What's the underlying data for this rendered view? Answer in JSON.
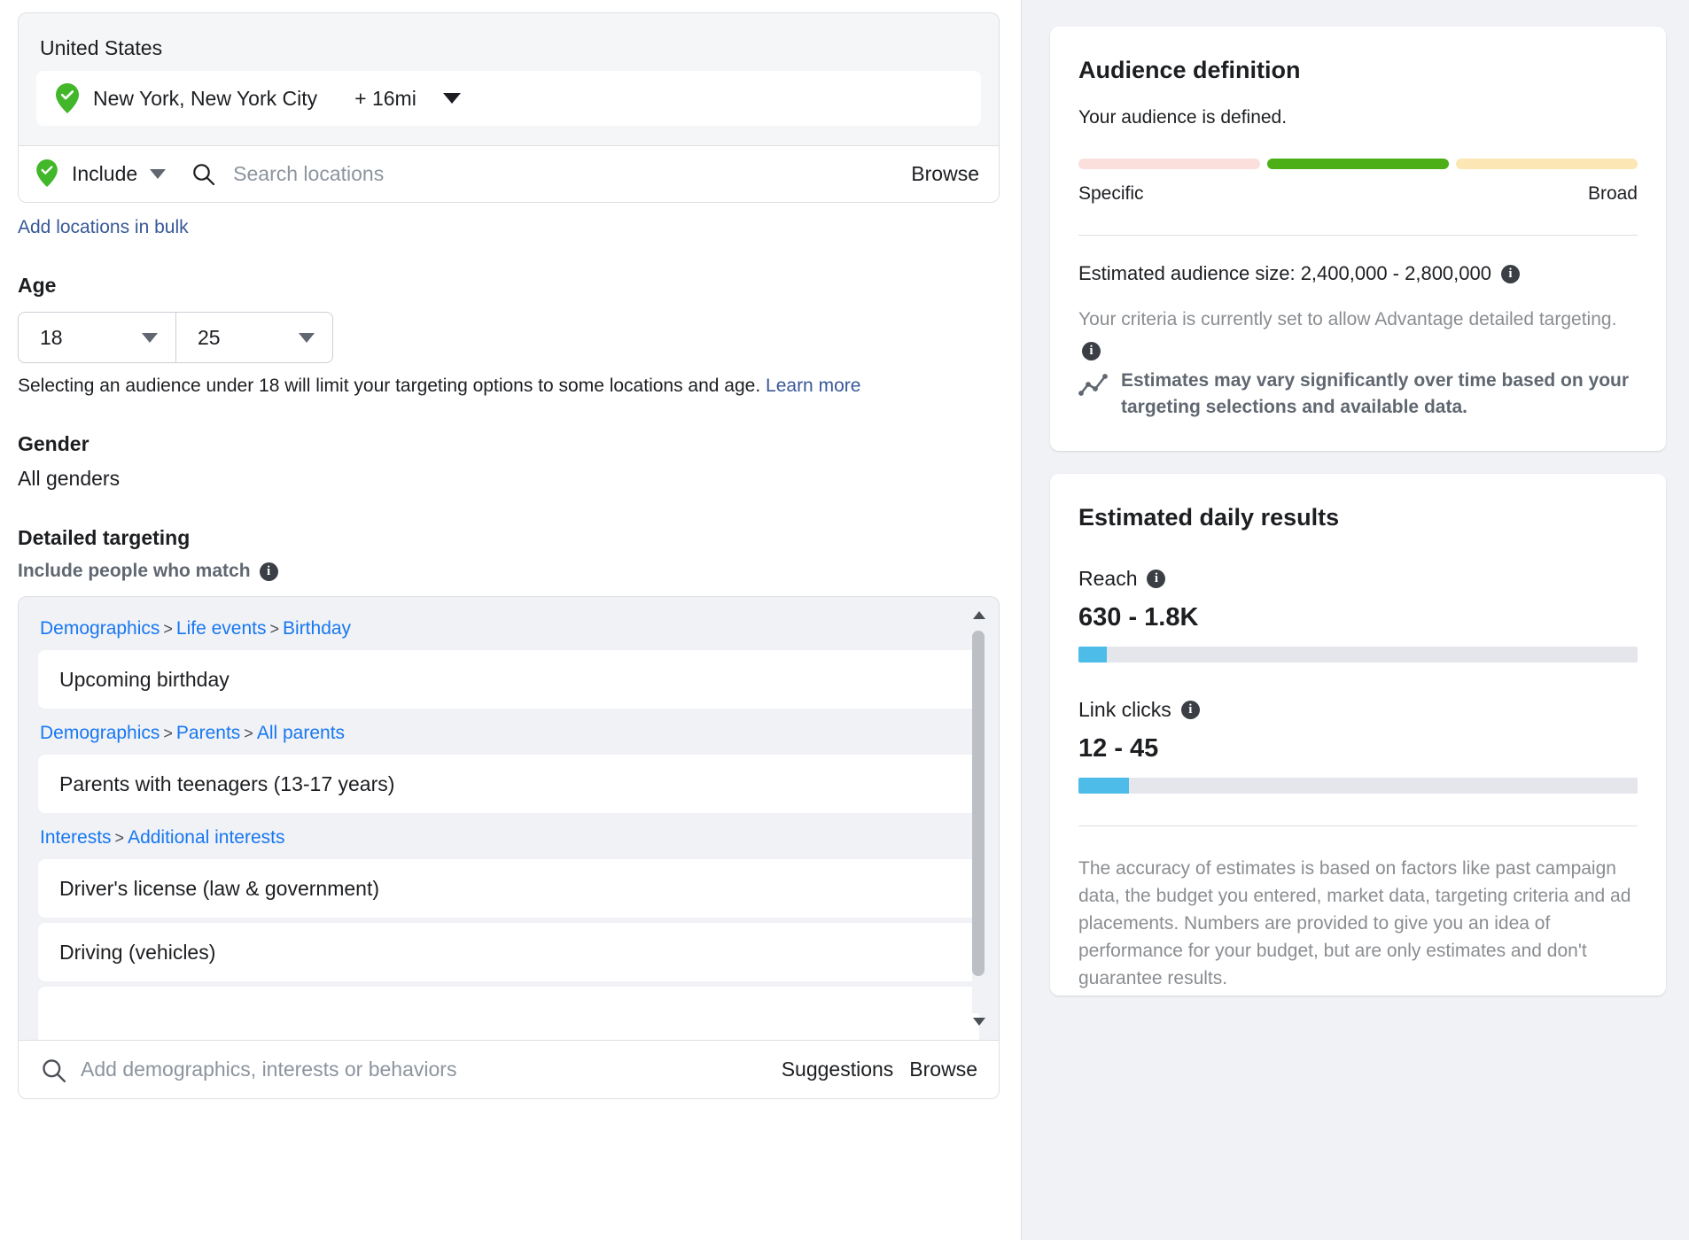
{
  "location": {
    "country": "United States",
    "selected_location": "New York, New York City",
    "radius": "+ 16mi",
    "include_label": "Include",
    "search_placeholder": "Search locations",
    "browse_label": "Browse",
    "bulk_link": "Add locations in bulk"
  },
  "age": {
    "title": "Age",
    "min": "18",
    "max": "25",
    "note": "Selecting an audience under 18 will limit your targeting options to some locations and age.",
    "note_link": "Learn more"
  },
  "gender": {
    "title": "Gender",
    "value": "All genders"
  },
  "detailed_targeting": {
    "title": "Detailed targeting",
    "subtitle": "Include people who match",
    "groups": [
      {
        "breadcrumb": [
          "Demographics",
          "Life events",
          "Birthday"
        ],
        "items": [
          "Upcoming birthday"
        ]
      },
      {
        "breadcrumb": [
          "Demographics",
          "Parents",
          "All parents"
        ],
        "items": [
          "Parents with teenagers (13-17 years)"
        ]
      },
      {
        "breadcrumb": [
          "Interests",
          "Additional interests"
        ],
        "items": [
          "Driver's license (law & government)",
          "Driving (vehicles)"
        ]
      }
    ],
    "search_placeholder": "Add demographics, interests or behaviors",
    "suggestions_label": "Suggestions",
    "browse_label": "Browse"
  },
  "audience_definition": {
    "title": "Audience definition",
    "status": "Your audience is defined.",
    "meter": {
      "segments": [
        "#fbdfdc",
        "#4caf17",
        "#fbe6b4"
      ],
      "active_index": 1,
      "left_label": "Specific",
      "right_label": "Broad"
    },
    "estimated_audience_size": "Estimated audience size: 2,400,000 - 2,800,000",
    "criteria_note": "Your criteria is currently set to allow Advantage detailed targeting.",
    "vary_note": "Estimates may vary significantly over time based on your targeting selections and available data."
  },
  "estimated_daily_results": {
    "title": "Estimated daily results",
    "metrics": [
      {
        "label": "Reach",
        "value": "630 - 1.8K",
        "fill_percent": 5
      },
      {
        "label": "Link clicks",
        "value": "12 - 45",
        "fill_percent": 9
      }
    ],
    "footer": "The accuracy of estimates is based on factors like past campaign data, the budget you entered, market data, targeting criteria and ad placements. Numbers are provided to give you an idea of performance for your budget, but are only estimates and don't guarantee results."
  },
  "colors": {
    "link": "#1877f2",
    "link_dark": "#385898",
    "bar_fill": "#4dbce9",
    "pin_green": "#42b72a"
  }
}
